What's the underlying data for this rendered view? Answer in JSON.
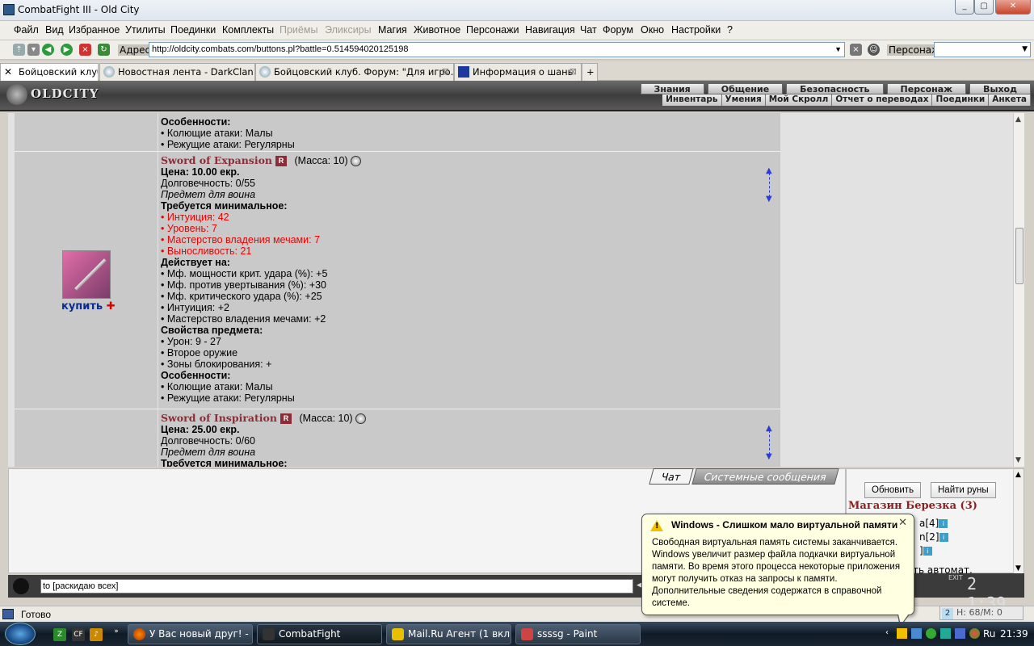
{
  "window": {
    "title": "CombatFight III - Old City"
  },
  "menu": [
    "Файл",
    "Вид",
    "Избранное",
    "Утилиты",
    "Поединки",
    "Комплекты",
    "Приёмы",
    "Эликсиры",
    "Магия",
    "Животное",
    "Персонажи",
    "Навигация",
    "Чат",
    "Форум",
    "Окно",
    "Настройки",
    "?"
  ],
  "menu_disabled": [
    "Приёмы",
    "Эликсиры"
  ],
  "address": {
    "label": "Адрес:",
    "url": "http://oldcity.combats.com/buttons.pl?battle=0.514594020125198",
    "char_label": "Персонаж:"
  },
  "tabs": [
    {
      "label": "Бойцовский клуб"
    },
    {
      "label": "Новостная лента - DarkClan"
    },
    {
      "label": "Бойцовский клуб. Форум: \"Для игро..."
    },
    {
      "label": "Информация о шань"
    }
  ],
  "game": {
    "logo": "OLDCITY",
    "nav_top": [
      "Знания",
      "Общение",
      "Безопасность",
      "Персонаж",
      "Выход"
    ],
    "nav_bottom": [
      "Инвентарь",
      "Умения",
      "Мой Скролл",
      "Отчет о переводах",
      "Поединки",
      "Анкета"
    ]
  },
  "prev_item": {
    "features_title": "Особенности:",
    "lines": [
      "• Колющие атаки: Малы",
      "• Режущие атаки: Регулярны"
    ]
  },
  "item1": {
    "name": "Sword of Expansion",
    "rarity": "R",
    "mass": "(Масса: 10)",
    "price": "Цена: 10.00 екр.",
    "durability": "Долговечность: 0/55",
    "for_class": "Предмет для воина",
    "req_title": "Требуется минимальное:",
    "reqs": [
      "• Интуиция: 42",
      "• Уровень: 7",
      "• Мастерство владения мечами: 7",
      "• Выносливость: 21"
    ],
    "acts_title": "Действует на:",
    "acts": [
      "• Мф. мощности крит. удара (%): +5",
      "• Мф. против увертывания (%): +30",
      "• Мф. критического удара (%): +25",
      "• Интуиция: +2",
      "• Мастерство владения мечами: +2"
    ],
    "props_title": "Свойства предмета:",
    "props": [
      "• Урон: 9 - 27",
      "• Второе оружие",
      "• Зоны блокирования: +"
    ],
    "features_title": "Особенности:",
    "features": [
      "• Колющие атаки: Малы",
      "• Режущие атаки: Регулярны"
    ],
    "buy_label": "купить"
  },
  "item2": {
    "name": "Sword of Inspiration",
    "rarity": "R",
    "mass": "(Масса: 10)",
    "price": "Цена: 25.00 екр.",
    "durability": "Долговечность: 0/60",
    "for_class": "Предмет для воина",
    "cut_text": "Требуется минимальное:"
  },
  "chat": {
    "tab_chat": "Чат",
    "tab_system": "Системные сообщения",
    "input_value": "to [раскидаю всех]"
  },
  "right_panel": {
    "refresh_label": "Обновить",
    "find_runes_label": "Найти руны",
    "shop_name": "Магазин Березка (3)",
    "players": [
      "a[4]",
      "n[2]",
      "]"
    ],
    "auto_text": "ть автомат.",
    "clock": "2 1:39",
    "exit_label": "EXIT",
    "hm_label": "H: 68/M: 0",
    "hm_num": "2"
  },
  "status": {
    "text": "Готово"
  },
  "balloon": {
    "title": "Windows - Слишком мало виртуальной памяти",
    "body": "Свободная виртуальная память системы заканчивается. Windows увеличит размер файла подкачки виртуальной памяти. Во время этого процесса некоторые приложения могут получить отказ на запросы к памяти. Дополнительные сведения содержатся в справочной системе."
  },
  "taskbar": {
    "buttons": [
      "У Вас новый друг! - ...",
      "CombatFight",
      "Mail.Ru Агент (1 вкл...",
      "ssssg - Paint"
    ],
    "lang": "Ru",
    "time": "21:39"
  },
  "colors": {
    "item_name": "#8b2d38",
    "req_red": "#e00000",
    "buy_blue": "#0c2c8e",
    "balloon_bg": "#ffffe1"
  }
}
